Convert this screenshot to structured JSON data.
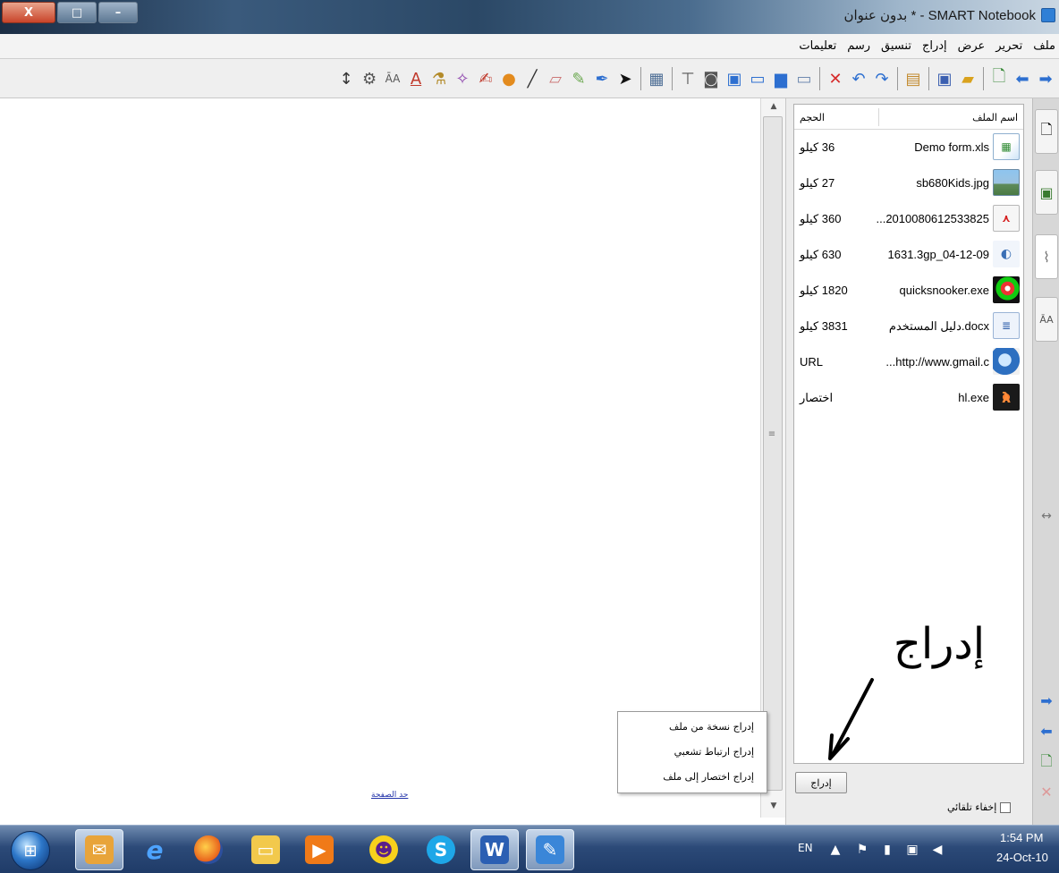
{
  "window": {
    "title": "SMART Notebook - * بدون عنوان",
    "buttons": {
      "close": "X",
      "maximize": "□",
      "minimize": "–"
    }
  },
  "menubar": [
    "ملف",
    "تحرير",
    "عرض",
    "إدراج",
    "تنسيق",
    "رسم",
    "تعليمات"
  ],
  "toolbar": {
    "icons": [
      "forward-arrow-icon",
      "back-arrow-icon",
      "new-page-icon",
      "open-folder-icon",
      "save-icon",
      "paste-icon",
      "redo-icon",
      "undo-icon",
      "delete-icon",
      "screen-shade-icon",
      "screen-monitor-icon",
      "screen-display-icon",
      "screen-capture-icon",
      "document-camera-icon",
      "table-icon",
      "table-grid-icon",
      "select-pointer-icon",
      "pen-icon",
      "creative-pen-icon",
      "eraser-icon",
      "line-icon",
      "shape-icon",
      "magic-pen-icon",
      "magic-wand-icon",
      "fill-icon",
      "text-color-icon",
      "text-format-icon",
      "properties-icon",
      "more-options-icon"
    ]
  },
  "canvas": {
    "page_link": "حد الصفحة"
  },
  "file_panel": {
    "columns": {
      "name": "اسم الملف",
      "size": "الحجم"
    },
    "files": [
      {
        "name": "Demo form.xls",
        "size": "36 كيلو",
        "icon": "excel-file-icon"
      },
      {
        "name": "sb680Kids.jpg",
        "size": "27 كيلو",
        "icon": "image-file-icon"
      },
      {
        "name": "...2010080612533825",
        "size": "360 كيلو",
        "icon": "pdf-file-icon"
      },
      {
        "name": "1631.3gp_04-12-09",
        "size": "630 كيلو",
        "icon": "video-file-icon"
      },
      {
        "name": "quicksnooker.exe",
        "size": "1820 كيلو",
        "icon": "snooker-app-icon"
      },
      {
        "name": "دليل المستخدم.docx",
        "size": "3831 كيلو",
        "icon": "word-file-icon"
      },
      {
        "name": "...http://www.gmail.c",
        "size": "URL",
        "icon": "web-link-icon"
      },
      {
        "name": "hl.exe",
        "size": "اختصار",
        "icon": "halflife-app-icon"
      }
    ],
    "insert_button": "إدراج",
    "autohide_label": "إخفاء تلقائي"
  },
  "context_menu": [
    "إدراج نسخة من ملف",
    "إدراج ارتباط تشعبي",
    "إدراج اختصار إلى ملف"
  ],
  "annotation": {
    "text": "إدراج"
  },
  "side_tabs": [
    "page-sorter-icon",
    "gallery-icon",
    "attachments-icon",
    "properties-icon"
  ],
  "side_controls": [
    "resize-icon",
    "next-page-icon",
    "previous-page-icon",
    "add-page-icon",
    "delete-page-icon"
  ],
  "taskbar": {
    "apps": [
      "outlook-icon",
      "internet-explorer-icon",
      "firefox-icon",
      "explorer-icon",
      "media-player-icon",
      "yahoo-messenger-icon",
      "skype-icon",
      "word-icon",
      "smart-notebook-icon"
    ],
    "language": "EN",
    "time": "1:54 PM",
    "date": "24-Oct-10"
  },
  "colors": {
    "accent": "#2f7fd6",
    "taskbar": "#2c4a78",
    "delete_red": "#d62b2b"
  }
}
